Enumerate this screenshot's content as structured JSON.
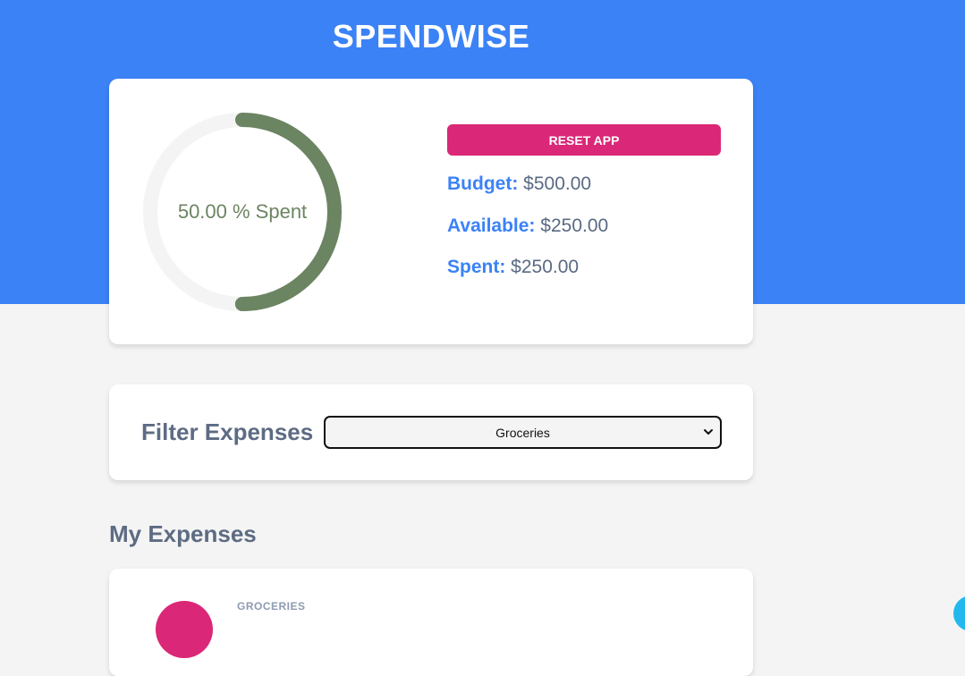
{
  "header": {
    "title": "SPENDWISE"
  },
  "summary": {
    "progress_label": "50.00 % Spent",
    "spent_fraction": 0.5,
    "reset_label": "RESET APP",
    "budget_key": "Budget:",
    "budget_value": "$500.00",
    "available_key": "Available:",
    "available_value": "$250.00",
    "spent_key": "Spent:",
    "spent_value": "$250.00"
  },
  "filter": {
    "label": "Filter Expenses",
    "selected": "Groceries"
  },
  "expenses": {
    "title": "My Expenses",
    "items": [
      {
        "category": "GROCERIES"
      }
    ]
  },
  "colors": {
    "primary": "#3b82f6",
    "accent": "#db2777",
    "progress": "#6b8462",
    "track": "#f4f4f4"
  }
}
